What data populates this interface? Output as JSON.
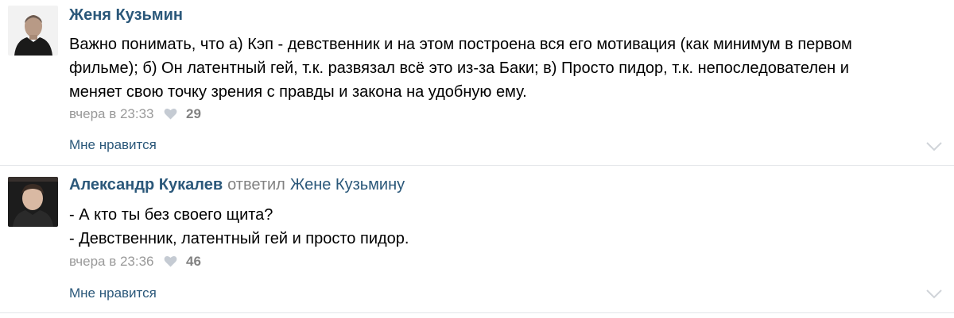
{
  "comments": [
    {
      "author": "Женя Кузьмин",
      "body": [
        "Важно понимать, что а) Кэп - девственник и на этом построена вся его мотивация (как минимум в первом",
        "фильме); б) Он латентный гей, т.к. развязал всё это из-за Баки; в) Просто пидор, т.к. непоследователен и",
        "меняет свою точку зрения с правды и закона на удобную ему."
      ],
      "time": "вчера в 23:33",
      "likes": "29",
      "like_label": "Мне нравится",
      "icons": {
        "like": "heart-icon",
        "expand": "chevron-down-icon"
      }
    },
    {
      "author": "Александр Кукалев",
      "reply_text": "ответил",
      "reply_to": "Жене Кузьмину",
      "body": [
        "- А кто ты без своего щита?",
        "- Девственник, латентный гей и просто пидор."
      ],
      "time": "вчера в 23:36",
      "likes": "46",
      "like_label": "Мне нравится",
      "icons": {
        "like": "heart-icon",
        "expand": "chevron-down-icon"
      }
    }
  ],
  "colors": {
    "author_link": "#2b587a",
    "meta_gray": "#999999",
    "divider": "#e4e6e9"
  }
}
